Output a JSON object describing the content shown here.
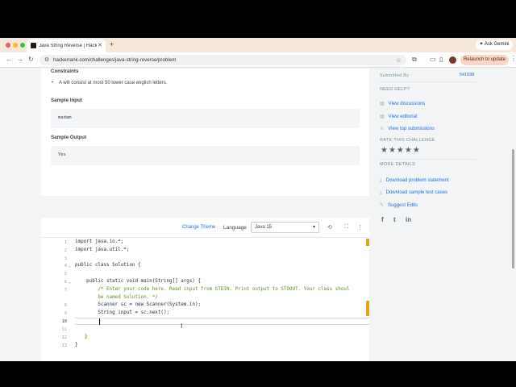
{
  "tab": {
    "title": "Java String Reverse | HackerR",
    "close": "✕",
    "new": "+"
  },
  "gemini": {
    "label": "Ask Gemini"
  },
  "address": {
    "url": "hackerrank.com/challenges/java-string-reverse/problem"
  },
  "relaunch": {
    "label": "Relaunch to update"
  },
  "problem": {
    "constraints_heading": "Constraints",
    "constraint_text": "A will consist at most 50 lower case english letters.",
    "sample_input_heading": "Sample Input",
    "sample_input": "madam",
    "sample_output_heading": "Sample Output",
    "sample_output": "Yes"
  },
  "sidebar": {
    "submitted_by_label": "Submitted By",
    "submitted_by_value": "541598",
    "need_help": "NEED HELP?",
    "help_links": [
      "View discussions",
      "View editorial",
      "View top submissions"
    ],
    "rate": "RATE THIS CHALLENGE",
    "stars": "★★★★★",
    "more_details": "MORE DETAILS",
    "detail_links": [
      "Download problem statement",
      "Download sample test cases",
      "Suggest Edits"
    ]
  },
  "editor": {
    "change_theme": "Change Theme",
    "language_label": "Language",
    "language_value": "Java 15",
    "lines": [
      {
        "n": "1",
        "text": "import java.io.*;"
      },
      {
        "n": "2",
        "text": "import java.util.*;"
      },
      {
        "n": "3",
        "text": ""
      },
      {
        "n": "4",
        "text": "public class Solution {"
      },
      {
        "n": "5",
        "text": ""
      },
      {
        "n": "6",
        "text": "    public static void main(String[] args) {"
      },
      {
        "n": "7",
        "text": "        /* Enter your code here. Read input from STDIN. Print output to STDOUT. Your class shoul"
      },
      {
        "n": "",
        "text": "        be named Solution. */"
      },
      {
        "n": "8",
        "text": "        Scanner sc = new Scanner(System.in);"
      },
      {
        "n": "9",
        "text": "        String input = sc.next();"
      },
      {
        "n": "10",
        "text": "        "
      },
      {
        "n": "11",
        "text": ""
      },
      {
        "n": "12",
        "text": "    }"
      },
      {
        "n": "13",
        "text": "}"
      }
    ]
  }
}
